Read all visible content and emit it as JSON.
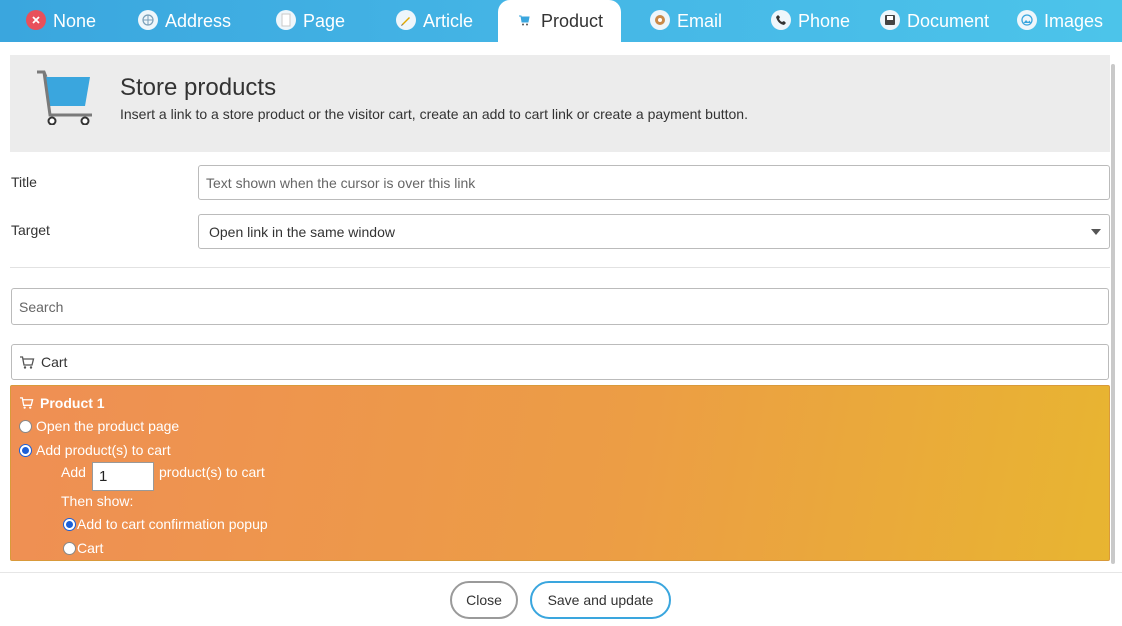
{
  "tabs": [
    {
      "label": "None",
      "icon": "none-icon"
    },
    {
      "label": "Address",
      "icon": "address-icon"
    },
    {
      "label": "Page",
      "icon": "page-icon"
    },
    {
      "label": "Article",
      "icon": "article-icon"
    },
    {
      "label": "Product",
      "icon": "cart-icon",
      "active": true
    },
    {
      "label": "Email",
      "icon": "email-icon"
    },
    {
      "label": "Phone",
      "icon": "phone-icon"
    },
    {
      "label": "Document",
      "icon": "document-icon"
    },
    {
      "label": "Images",
      "icon": "images-icon"
    }
  ],
  "header": {
    "title": "Store products",
    "subtitle": "Insert a link to a store product or the visitor cart, create an add to cart link or create a payment button.",
    "icon": "shopping-cart-icon"
  },
  "form": {
    "title_label": "Title",
    "title_placeholder": "Text shown when the cursor is over this link",
    "target_label": "Target",
    "target_value": "Open link in the same window"
  },
  "search": {
    "placeholder": "Search"
  },
  "cart": {
    "label": "Cart"
  },
  "product": {
    "name": "Product 1",
    "option_open": "Open the product page",
    "option_add": "Add product(s) to cart",
    "add_prefix": "Add",
    "quantity": "1",
    "add_suffix": "product(s) to cart",
    "then_show": "Then show:",
    "show_popup": "Add to cart confirmation popup",
    "show_cart": "Cart"
  },
  "footer": {
    "close_label": "Close",
    "save_label": "Save and update"
  },
  "colors": {
    "tab_bar": "#3aa6de",
    "accent": "#3aa6de",
    "product_panel_start": "#ef8f54",
    "product_panel_end": "#e8b531",
    "radio_checked": "#1b5fd8"
  }
}
